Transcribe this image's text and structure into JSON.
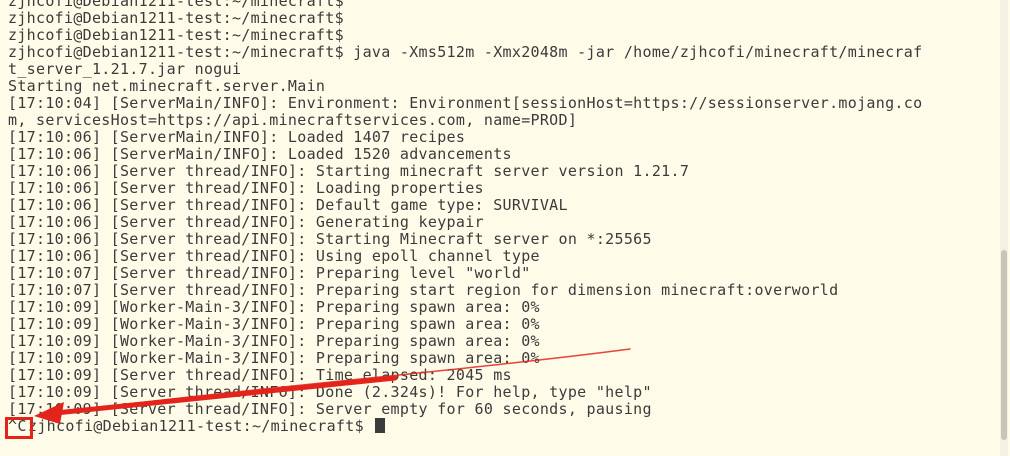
{
  "terminal": {
    "lines": [
      "zjhcofi@Debian1211-test:~/minecraft$",
      "zjhcofi@Debian1211-test:~/minecraft$",
      "zjhcofi@Debian1211-test:~/minecraft$",
      "zjhcofi@Debian1211-test:~/minecraft$ java -Xms512m -Xmx2048m -jar /home/zjhcofi/minecraft/minecraf",
      "t_server_1.21.7.jar nogui",
      "Starting net.minecraft.server.Main",
      "[17:10:04] [ServerMain/INFO]: Environment: Environment[sessionHost=https://sessionserver.mojang.co",
      "m, servicesHost=https://api.minecraftservices.com, name=PROD]",
      "[17:10:06] [ServerMain/INFO]: Loaded 1407 recipes",
      "[17:10:06] [ServerMain/INFO]: Loaded 1520 advancements",
      "[17:10:06] [Server thread/INFO]: Starting minecraft server version 1.21.7",
      "[17:10:06] [Server thread/INFO]: Loading properties",
      "[17:10:06] [Server thread/INFO]: Default game type: SURVIVAL",
      "[17:10:06] [Server thread/INFO]: Generating keypair",
      "[17:10:06] [Server thread/INFO]: Starting Minecraft server on *:25565",
      "[17:10:06] [Server thread/INFO]: Using epoll channel type",
      "[17:10:07] [Server thread/INFO]: Preparing level \"world\"",
      "[17:10:07] [Server thread/INFO]: Preparing start region for dimension minecraft:overworld",
      "[17:10:09] [Worker-Main-3/INFO]: Preparing spawn area: 0%",
      "[17:10:09] [Worker-Main-3/INFO]: Preparing spawn area: 0%",
      "[17:10:09] [Worker-Main-3/INFO]: Preparing spawn area: 0%",
      "[17:10:09] [Worker-Main-3/INFO]: Preparing spawn area: 0%",
      "[17:10:09] [Server thread/INFO]: Time elapsed: 2045 ms",
      "[17:10:09] [Server thread/INFO]: Done (2.324s)! For help, type \"help\"",
      "[17:10:09] [Server thread/INFO]: Server empty for 60 seconds, pausing"
    ],
    "interrupt_text": "^C",
    "prompt": "zjhcofi@Debian1211-test:~/minecraft$ "
  },
  "colors": {
    "background": "#fefce9",
    "text": "#3b3b3b",
    "annotation": "#e4231b"
  },
  "icons": {
    "cursor": "block-cursor",
    "annotation": "red-arrow"
  }
}
